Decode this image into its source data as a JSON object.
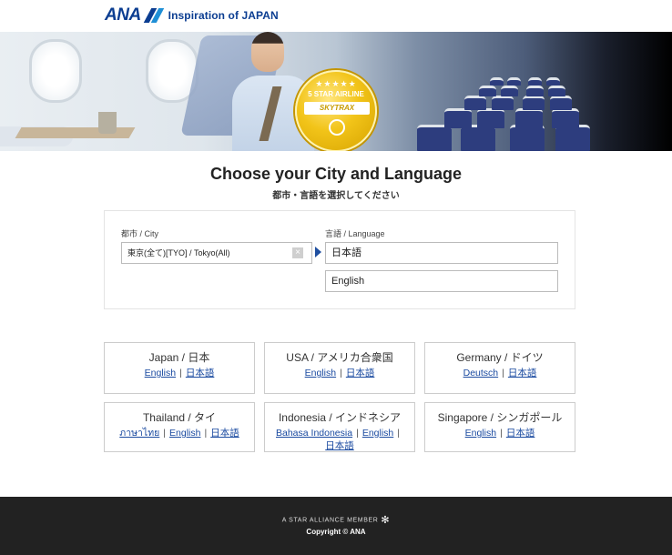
{
  "header": {
    "logo_text": "ANA",
    "tagline": "Inspiration of JAPAN"
  },
  "hero": {
    "badge_stars": "★★★★★",
    "badge_line1": "5 STAR AIRLINE",
    "badge_brand": "SKYTRAX"
  },
  "title": {
    "main": "Choose your City and Language",
    "sub": "都市・言語を選択してください"
  },
  "selector": {
    "city_label": "都市 / City",
    "city_value": "東京(全て)[TYO] / Tokyo(All)",
    "clear_symbol": "×",
    "language_label": "言語 / Language",
    "languages": [
      "日本語",
      "English"
    ]
  },
  "countries": [
    {
      "name": "Japan / 日本",
      "links": [
        "English",
        "日本語"
      ]
    },
    {
      "name": "USA / アメリカ合衆国",
      "links": [
        "English",
        "日本語"
      ]
    },
    {
      "name": "Germany / ドイツ",
      "links": [
        "Deutsch",
        "日本語"
      ]
    },
    {
      "name": "Thailand / タイ",
      "links": [
        "ภาษาไทย",
        "English",
        "日本語"
      ]
    },
    {
      "name": "Indonesia / インドネシア",
      "links": [
        "Bahasa Indonesia",
        "English",
        "日本語"
      ]
    },
    {
      "name": "Singapore / シンガポール",
      "links": [
        "English",
        "日本語"
      ]
    }
  ],
  "footer": {
    "alliance": "A STAR ALLIANCE MEMBER",
    "alliance_icon": "✻",
    "copyright": "Copyright © ANA"
  }
}
